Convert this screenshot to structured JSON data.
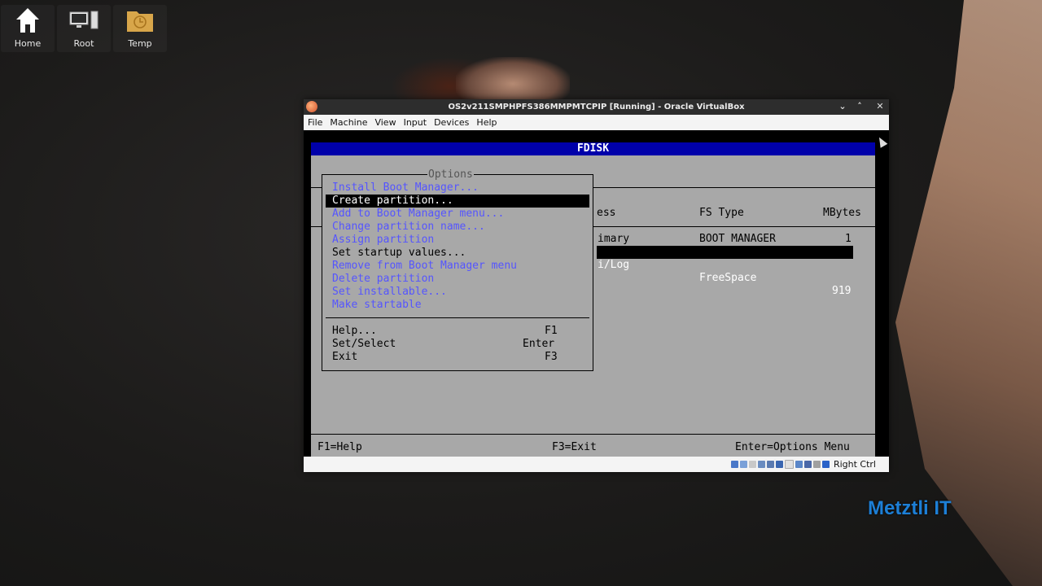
{
  "desktop": {
    "icons": [
      {
        "label": "Home",
        "icon": "home-icon"
      },
      {
        "label": "Root",
        "icon": "computer-icon"
      },
      {
        "label": "Temp",
        "icon": "folder-clock-icon"
      }
    ]
  },
  "window": {
    "title": "OS2v211SMPHPFS386MMPMTCPIP [Running] - Oracle VirtualBox",
    "menu": [
      "File",
      "Machine",
      "View",
      "Input",
      "Devices",
      "Help"
    ],
    "host_key": "Right Ctrl"
  },
  "fdisk": {
    "title": "FDISK",
    "columns": {
      "access": "ess",
      "fs_type": "FS Type",
      "mbytes": "MBytes"
    },
    "rows": [
      {
        "access": "imary",
        "fs_type": "BOOT MANAGER",
        "mbytes": "1"
      },
      {
        "access": "i/Log",
        "fs_type": "FreeSpace",
        "mbytes": "919"
      }
    ],
    "options": {
      "title": "Options",
      "items": [
        {
          "label": "Install Boot Manager...",
          "enabled": false
        },
        {
          "label": "Create partition...",
          "enabled": true,
          "selected": true
        },
        {
          "label": "Add to Boot Manager menu...",
          "enabled": false
        },
        {
          "label": "Change partition name...",
          "enabled": false
        },
        {
          "label": "Assign partition",
          "enabled": false
        },
        {
          "label": "Set startup values...",
          "enabled": true
        },
        {
          "label": "Remove from Boot Manager menu",
          "enabled": false
        },
        {
          "label": "Delete partition",
          "enabled": false
        },
        {
          "label": "Set installable...",
          "enabled": false
        },
        {
          "label": "Make startable",
          "enabled": false
        }
      ],
      "help": {
        "label": "Help...",
        "key": "F1"
      },
      "select": {
        "label": "Set/Select",
        "key": "Enter"
      },
      "exit": {
        "label": "Exit",
        "key": "F3"
      }
    },
    "footer": {
      "left": "F1=Help",
      "center": "F3=Exit",
      "right": "Enter=Options Menu"
    }
  },
  "watermark": "Metztli IT"
}
